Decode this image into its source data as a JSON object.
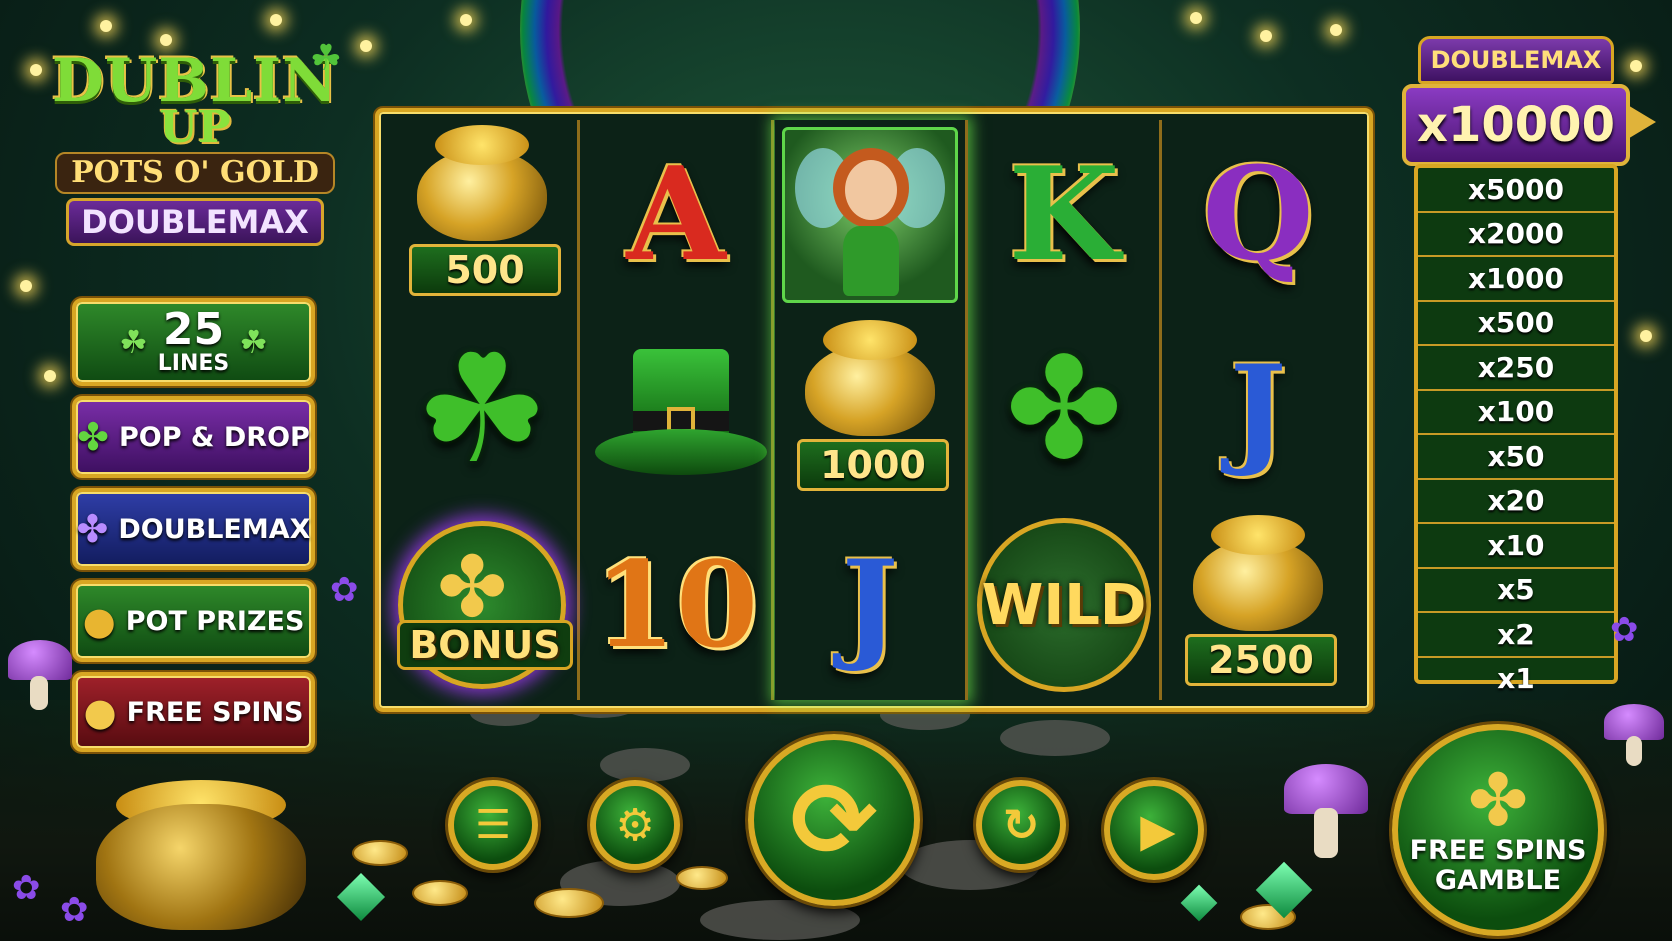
{
  "logo": {
    "line1": "DUBLIN",
    "line2": "UP",
    "line3": "POTS O' GOLD",
    "line4": "DOUBLEMAX",
    "clover_icon": "shamrock-icon"
  },
  "features": {
    "lines_number": "25",
    "lines_label": "LINES",
    "items": [
      {
        "label": "POP & DROP",
        "icon": "four-leaf-clover-icon",
        "color": "#7a2ea8"
      },
      {
        "label": "DOUBLEMAX",
        "icon": "purple-clover-icon",
        "color": "#2f3ea8"
      },
      {
        "label": "POT PRIZES",
        "icon": "pot-of-gold-icon",
        "color": "#2f8a2a"
      },
      {
        "label": "FREE SPINS",
        "icon": "gold-coin-icon",
        "color": "#a0212a"
      }
    ]
  },
  "reels": {
    "columns": [
      [
        {
          "symbol": "pot-of-gold",
          "value": "500"
        },
        {
          "symbol": "shamrock"
        },
        {
          "symbol": "bonus",
          "label": "BONUS"
        }
      ],
      [
        {
          "symbol": "letter",
          "text": "A",
          "color": "#d92a1f"
        },
        {
          "symbol": "leprechaun-hat"
        },
        {
          "symbol": "letter",
          "text": "10",
          "color": "#e07516"
        }
      ],
      [
        {
          "symbol": "fairy"
        },
        {
          "symbol": "pot-of-gold",
          "value": "1000"
        },
        {
          "symbol": "letter",
          "text": "J",
          "color": "#2a5ad6"
        }
      ],
      [
        {
          "symbol": "letter",
          "text": "K",
          "color": "#2aae36"
        },
        {
          "symbol": "four-leaf-clover"
        },
        {
          "symbol": "wild",
          "label": "WILD"
        }
      ],
      [
        {
          "symbol": "letter",
          "text": "Q",
          "color": "#8a2ec0"
        },
        {
          "symbol": "letter",
          "text": "J",
          "color": "#2a5ad6"
        },
        {
          "symbol": "pot-of-gold",
          "value": "2500"
        }
      ]
    ]
  },
  "multiplier": {
    "badge": "DOUBLEMAX",
    "current": "x10000",
    "ladder": [
      "x5000",
      "x2000",
      "x1000",
      "x500",
      "x250",
      "x100",
      "x50",
      "x20",
      "x10",
      "x5",
      "x2",
      "x1"
    ]
  },
  "controls": {
    "menu_icon": "menu-icon",
    "settings_icon": "gear-icon",
    "spin_icon": "spin-arrows-icon",
    "autoplay_icon": "autoplay-icon",
    "play_icon": "play-icon",
    "free_spins_gamble_line1": "FREE SPINS",
    "free_spins_gamble_line2": "GAMBLE"
  }
}
